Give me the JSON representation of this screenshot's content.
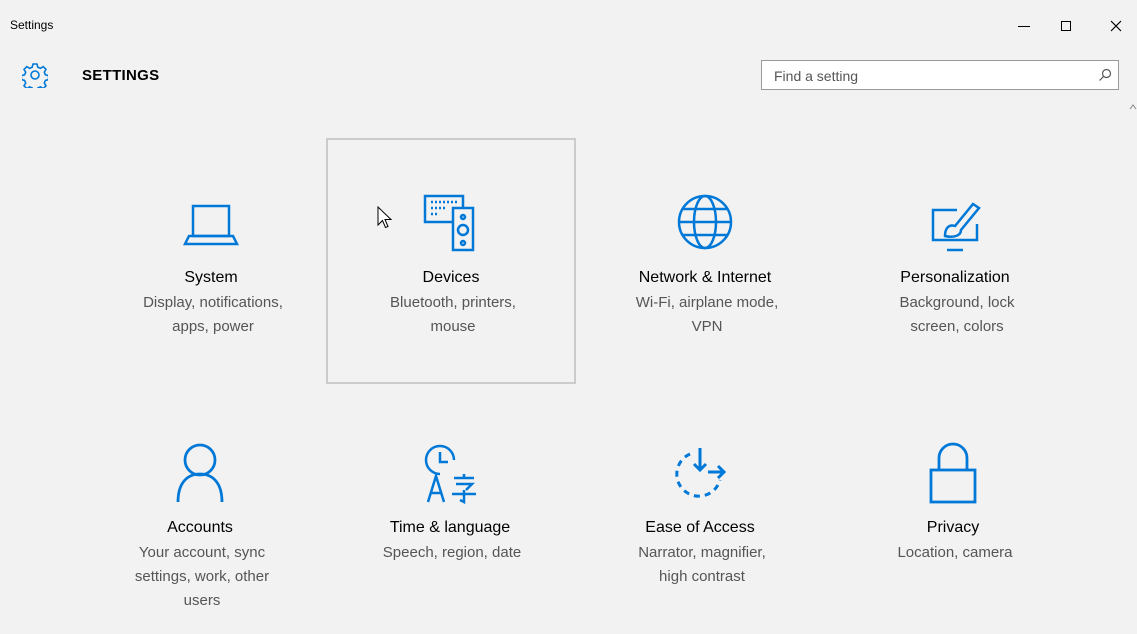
{
  "window": {
    "title": "Settings"
  },
  "header": {
    "title": "SETTINGS"
  },
  "search": {
    "placeholder": "Find a setting"
  },
  "accent": "#0078d7",
  "tiles": [
    {
      "name": "System",
      "desc1": "Display, notifications,",
      "desc2": "apps, power",
      "icon": "laptop-icon"
    },
    {
      "name": "Devices",
      "desc1": "Bluetooth, printers,",
      "desc2": "mouse",
      "icon": "devices-icon"
    },
    {
      "name": "Network & Internet",
      "desc1": "Wi-Fi, airplane mode,",
      "desc2": "VPN",
      "icon": "globe-icon"
    },
    {
      "name": "Personalization",
      "desc1": "Background, lock",
      "desc2": "screen, colors",
      "icon": "paint-icon"
    },
    {
      "name": "Accounts",
      "desc1": "Your account, sync",
      "desc2": "settings, work, other",
      "desc3": "users",
      "icon": "person-icon"
    },
    {
      "name": "Time & language",
      "desc1": "Speech, region, date",
      "desc2": "",
      "icon": "time-language-icon"
    },
    {
      "name": "Ease of Access",
      "desc1": "Narrator, magnifier,",
      "desc2": "high contrast",
      "icon": "ease-of-access-icon"
    },
    {
      "name": "Privacy",
      "desc1": "Location, camera",
      "desc2": "",
      "icon": "lock-icon"
    }
  ]
}
